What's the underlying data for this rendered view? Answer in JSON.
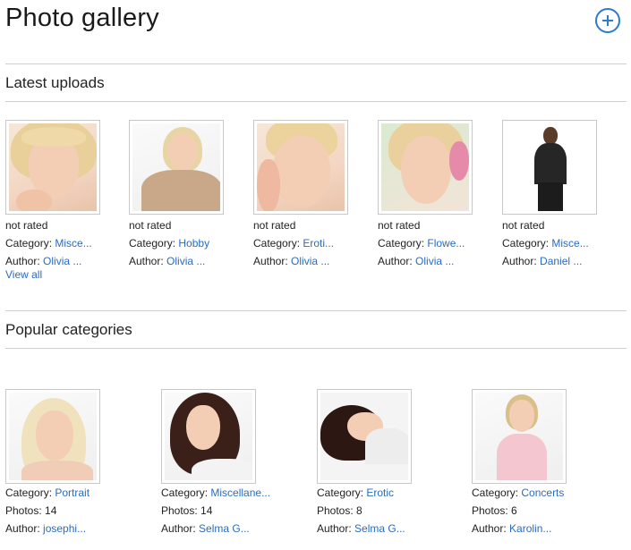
{
  "header": {
    "title": "Photo gallery",
    "add_icon": "plus-circle-icon",
    "accent": "#2a7bd1"
  },
  "latest": {
    "title": "Latest uploads",
    "view_all": "View all",
    "items": [
      {
        "rating": "not rated",
        "category_label": "Category:",
        "category": "Misce...",
        "author_label": "Author:",
        "author": "Olivia ..."
      },
      {
        "rating": "not rated",
        "category_label": "Category:",
        "category": "Hobby",
        "author_label": "Author:",
        "author": "Olivia ..."
      },
      {
        "rating": "not rated",
        "category_label": "Category:",
        "category": "Eroti...",
        "author_label": "Author:",
        "author": "Olivia ..."
      },
      {
        "rating": "not rated",
        "category_label": "Category:",
        "category": "Flowe...",
        "author_label": "Author:",
        "author": "Olivia ..."
      },
      {
        "rating": "not rated",
        "category_label": "Category:",
        "category": "Misce...",
        "author_label": "Author:",
        "author": "Daniel ..."
      }
    ]
  },
  "popular": {
    "title": "Popular categories",
    "items": [
      {
        "category_label": "Category:",
        "category": "Portrait",
        "photos_label": "Photos:",
        "photos": "14",
        "author_label": "Author:",
        "author": "josephi..."
      },
      {
        "category_label": "Category:",
        "category": "Miscellane...",
        "photos_label": "Photos:",
        "photos": "14",
        "author_label": "Author:",
        "author": "Selma G..."
      },
      {
        "category_label": "Category:",
        "category": "Erotic",
        "photos_label": "Photos:",
        "photos": "8",
        "author_label": "Author:",
        "author": "Selma G..."
      },
      {
        "category_label": "Category:",
        "category": "Concerts",
        "photos_label": "Photos:",
        "photos": "6",
        "author_label": "Author:",
        "author": "Karolin..."
      }
    ]
  }
}
